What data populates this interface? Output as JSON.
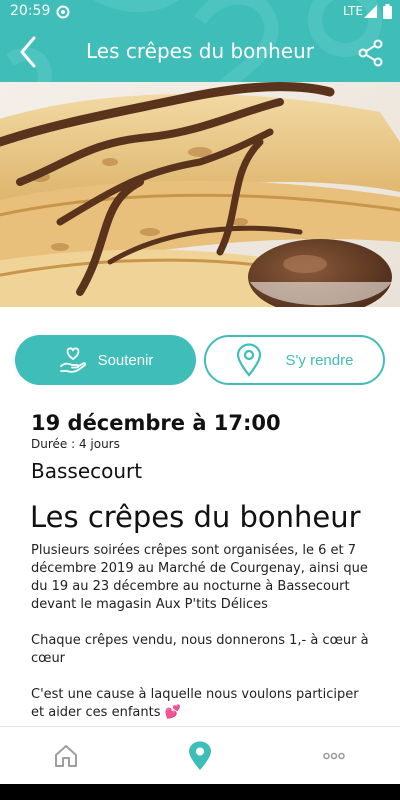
{
  "status_bar": {
    "time": "20:59",
    "network": "LTE"
  },
  "app_bar": {
    "title": "Les crêpes du bonheur"
  },
  "actions": {
    "support_label": "Soutenir",
    "go_label": "S'y rendre"
  },
  "event": {
    "date": "19 décembre à 17:00",
    "duration": "Durée : 4 jours",
    "location": "Bassecourt",
    "title": "Les crêpes du bonheur",
    "paragraphs": [
      "Plusieurs soirées crêpes sont organisées, le 6 et 7 décembre 2019 au Marché de Courgenay, ainsi que du 19 au 23 décembre au nocturne à  Bassecourt devant le magasin Aux P'tits Délices",
      "Chaque crêpes vendu, nous donnerons 1,- à cœur à cœur",
      "C'est une cause à laquelle nous voulons participer et aider ces enfants"
    ],
    "emoji": "💕"
  },
  "bottom_nav": {
    "items": [
      "home-icon",
      "map-pin-icon",
      "more-icon"
    ],
    "active": "map-pin-icon"
  },
  "colors": {
    "accent": "#3fbdb9",
    "inactive_icon": "#9e9e9e"
  }
}
